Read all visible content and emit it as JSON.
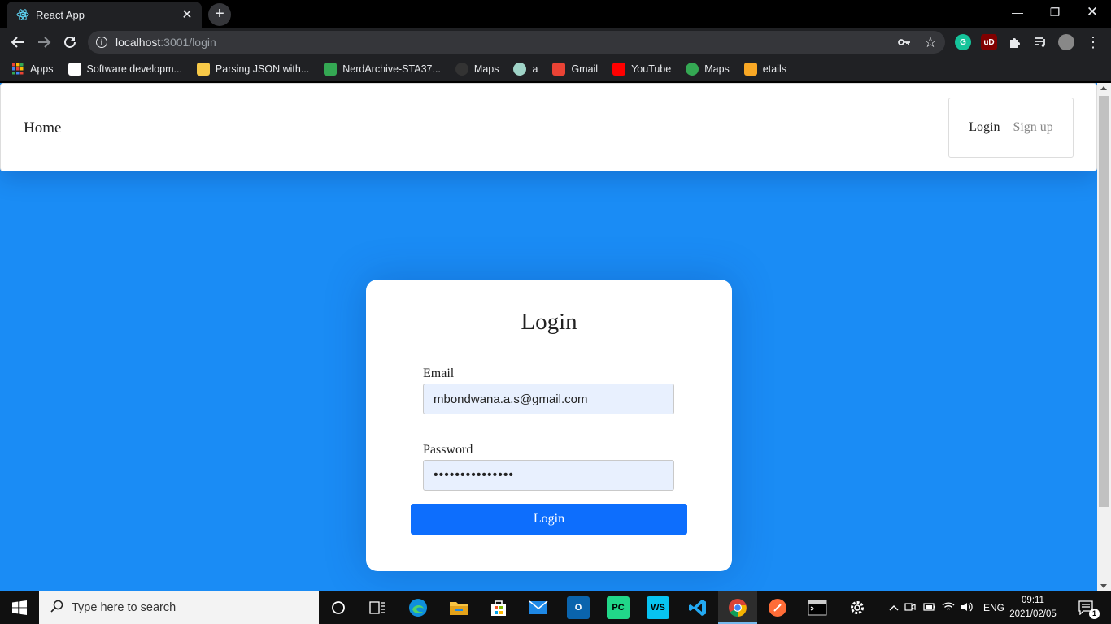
{
  "browser": {
    "tab_title": "React App",
    "url_host": "localhost",
    "url_path": ":3001/login",
    "bookmarks": [
      {
        "label": "Apps",
        "icon": "apps-grid-icon",
        "color": "#ea4335"
      },
      {
        "label": "Software developm...",
        "icon": "amazon-icon",
        "color": "#ffffff"
      },
      {
        "label": "Parsing JSON with...",
        "icon": "python-icon",
        "color": "#f7c948"
      },
      {
        "label": "NerdArchive-STA37...",
        "icon": "google-drive-icon",
        "color": "#34a853"
      },
      {
        "label": "Maps",
        "icon": "github-icon",
        "color": "#333333"
      },
      {
        "label": "a",
        "icon": "globe-icon",
        "color": "#9fd3c7"
      },
      {
        "label": "Gmail",
        "icon": "gmail-icon",
        "color": "#ea4335"
      },
      {
        "label": "YouTube",
        "icon": "youtube-icon",
        "color": "#ff0000"
      },
      {
        "label": "Maps",
        "icon": "google-maps-icon",
        "color": "#34a853"
      },
      {
        "label": "etails",
        "icon": "share-icon",
        "color": "#f9a825"
      }
    ]
  },
  "navbar": {
    "home": "Home",
    "login": "Login",
    "signup": "Sign up"
  },
  "login_form": {
    "title": "Login",
    "email_label": "Email",
    "email_value": "mbondwana.a.s@gmail.com",
    "password_label": "Password",
    "password_value": "•••••••••••••••",
    "submit_label": "Login"
  },
  "taskbar": {
    "search_placeholder": "Type here to search",
    "language": "ENG",
    "time": "09:11",
    "date": "2021/02/05",
    "notification_count": "1"
  },
  "colors": {
    "page_background": "#1a8cf5",
    "button": "#0d6efd",
    "input_autofill": "#e8f0fe"
  }
}
